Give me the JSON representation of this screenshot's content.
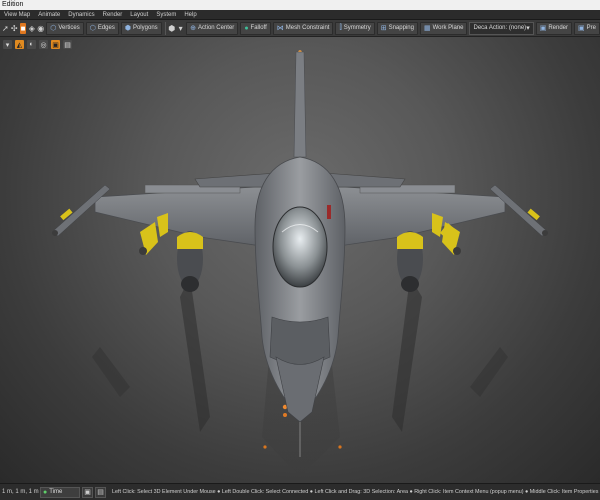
{
  "title_bar": {
    "title": "Edition"
  },
  "menu": [
    "View Map",
    "Animate",
    "Dynamics",
    "Render",
    "Layout",
    "System",
    "Help"
  ],
  "toolbar": {
    "vertices_label": "Vertices",
    "edges_label": "Edges",
    "polygons_label": "Polygons",
    "action_center_label": "Action Center",
    "falloff_label": "Falloff",
    "mesh_constraint_label": "Mesh Constraint",
    "symmetry_label": "Symmetry",
    "snapping_label": "Snapping",
    "work_plane_label": "Work Plane",
    "deca_action_value": "Deca Action: (none)",
    "render_label": "Render",
    "preview_label": "Pre"
  },
  "status": {
    "coords": "1 m, 1 m, 1 m",
    "time_label": "Time",
    "hint": "Left Click: Select 3D Element Under Mouse  ●  Left Double Click: Select Connected  ●  Left Click and Drag: 3D Selection: Area  ●  Right Click: Item Context Menu (popup menu)  ●  Middle Click: Item Properties (Generic)"
  },
  "colors": {
    "accent": "#e07820",
    "jet_body": "#7d8085",
    "missile_yellow": "#d8c21a"
  }
}
